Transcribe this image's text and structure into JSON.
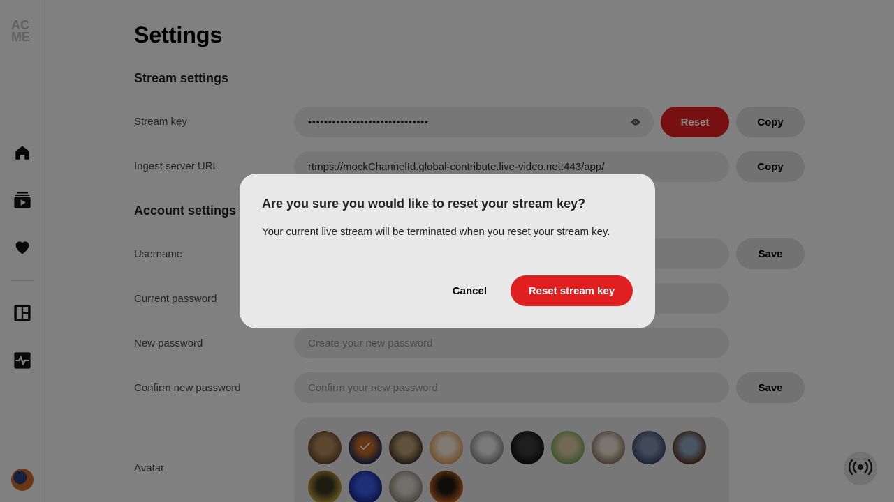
{
  "logo": {
    "text": "AC ME"
  },
  "nav": [
    {
      "icon": "home-icon"
    },
    {
      "icon": "videos-icon"
    },
    {
      "icon": "heart-icon"
    },
    {
      "icon": "dashboard-icon"
    },
    {
      "icon": "activity-icon"
    }
  ],
  "page": {
    "title": "Settings",
    "stream_settings_title": "Stream settings",
    "account_settings_title": "Account settings"
  },
  "stream": {
    "key_label": "Stream key",
    "key_value": "••••••••••••••••••••••••••••••",
    "reset_label": "Reset",
    "copy_label": "Copy",
    "ingest_label": "Ingest server URL",
    "ingest_value": "rtmps://mockChannelId.global-contribute.live-video.net:443/app/",
    "ingest_copy_label": "Copy"
  },
  "account": {
    "username_label": "Username",
    "username_save": "Save",
    "current_password_label": "Current password",
    "new_password_label": "New password",
    "new_password_placeholder": "Create your new password",
    "confirm_password_label": "Confirm new password",
    "confirm_password_placeholder": "Confirm your new password",
    "password_save": "Save",
    "avatar_label": "Avatar"
  },
  "avatars": [
    {
      "name": "bear",
      "colors": [
        "#6b4a2c",
        "#b0895a"
      ]
    },
    {
      "name": "bird",
      "colors": [
        "#1f2b55",
        "#c06a26"
      ],
      "selected": true
    },
    {
      "name": "owl",
      "colors": [
        "#4a3a28",
        "#b59a70"
      ]
    },
    {
      "name": "dog-shiba",
      "colors": [
        "#d89a5a",
        "#f2e6d6"
      ]
    },
    {
      "name": "dog-bull",
      "colors": [
        "#8a8a8a",
        "#e5e5e5"
      ]
    },
    {
      "name": "dog-pug",
      "colors": [
        "#141414",
        "#3a3a3a"
      ]
    },
    {
      "name": "giraffe",
      "colors": [
        "#7ba35a",
        "#d8c7a0"
      ]
    },
    {
      "name": "hedgehog",
      "colors": [
        "#8a7a66",
        "#e6ded0"
      ]
    },
    {
      "name": "hippo",
      "colors": [
        "#3d4a6a",
        "#7d8aa8"
      ]
    },
    {
      "name": "horse",
      "colors": [
        "#5a3a26",
        "#8aa0b5"
      ]
    },
    {
      "name": "gazelle",
      "colors": [
        "#b89a3a",
        "#3a3320"
      ]
    },
    {
      "name": "jellyfish",
      "colors": [
        "#1a2a8a",
        "#3a5ae0"
      ]
    },
    {
      "name": "sheep",
      "colors": [
        "#8a8678",
        "#d6d2c6"
      ]
    },
    {
      "name": "tiger",
      "colors": [
        "#c0621e",
        "#1e1a14"
      ]
    }
  ],
  "modal": {
    "title": "Are you sure you would like to reset your stream key?",
    "body": "Your current live stream will be terminated when you reset your stream key.",
    "cancel_label": "Cancel",
    "confirm_label": "Reset stream key"
  },
  "colors": {
    "accent": "#e02020",
    "overlay": "rgba(0,0,0,0.47)"
  }
}
